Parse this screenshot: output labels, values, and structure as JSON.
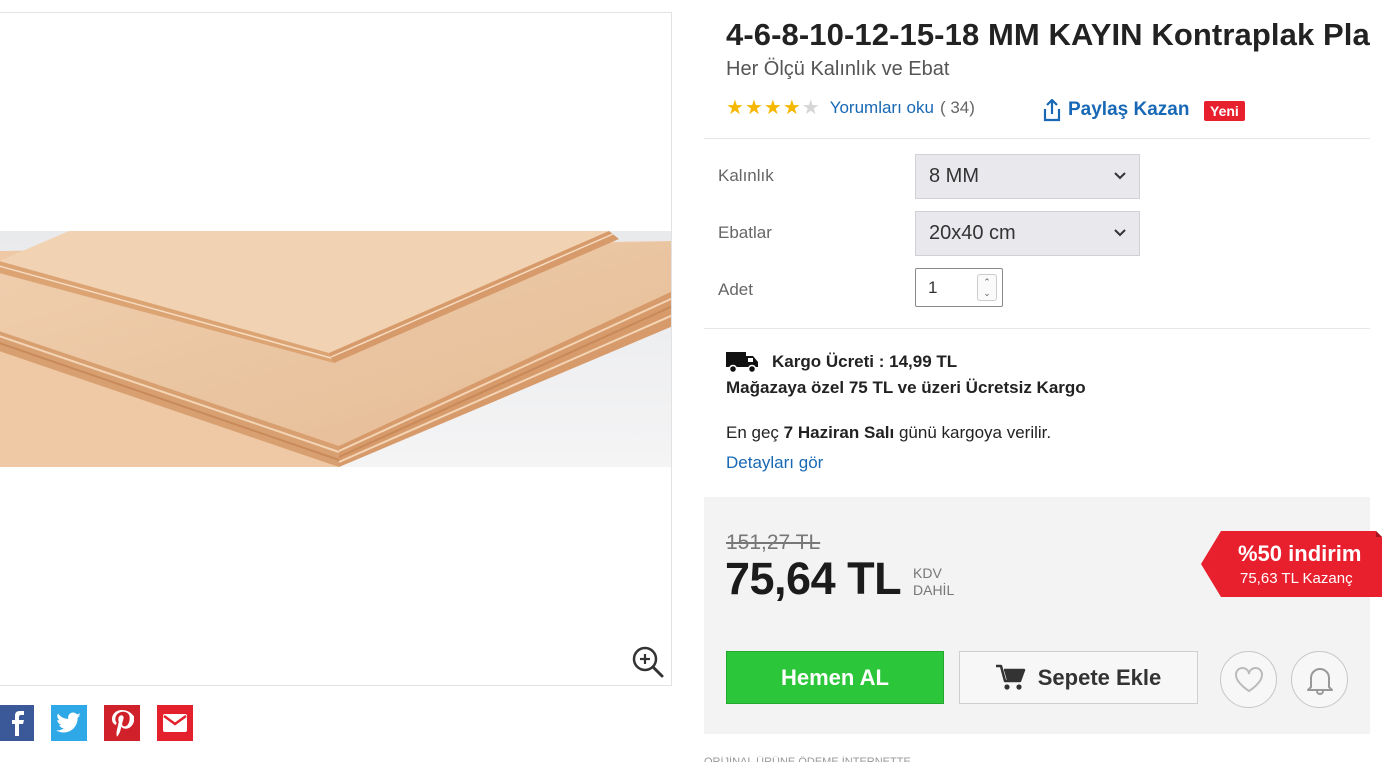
{
  "product": {
    "title": "4-6-8-10-12-15-18 MM KAYIN Kontraplak Pla",
    "subtitle": "Her Ölçü Kalınlık ve Ebat",
    "rating": 4,
    "rating_max": 5,
    "reviews_link": "Yorumları oku",
    "reviews_count": "( 34)",
    "share_label": "Paylaş Kazan",
    "new_badge": "Yeni"
  },
  "options": {
    "thickness_label": "Kalınlık",
    "thickness_value": "8 MM",
    "size_label": "Ebatlar",
    "size_value": "20x40 cm",
    "qty_label": "Adet",
    "qty_value": "1"
  },
  "shipping": {
    "cargo_fee": "Kargo Ücreti : 14,99 TL",
    "free_cargo": "Mağazaya özel 75 TL ve üzeri Ücretsiz Kargo",
    "delivery_prefix": "En geç",
    "delivery_date": "7 Haziran Salı",
    "delivery_suffix": "günü kargoya verilir.",
    "details_link": "Detayları gör"
  },
  "price": {
    "old": "151,27 TL",
    "current": "75,64 TL",
    "kdv_line1": "KDV",
    "kdv_line2": "DAHİL",
    "discount_title": "%50 indirim",
    "discount_sub": "75,63 TL Kazanç"
  },
  "actions": {
    "buy_now": "Hemen AL",
    "add_to_cart": "Sepete Ekle"
  },
  "bottom_strip": "ORİJİNAL ÜRÜNE    ÖDEME    İNTERNETTE",
  "colors": {
    "link": "#1868b5",
    "buy": "#2cc63a",
    "discount": "#e8202e",
    "star": "#f5b800"
  },
  "icons": [
    "zoom-in-icon",
    "share-icon",
    "truck-icon",
    "cart-icon",
    "heart-icon",
    "bell-icon",
    "facebook-icon",
    "twitter-icon",
    "pinterest-icon",
    "mail-icon",
    "chevron-down-icon"
  ]
}
